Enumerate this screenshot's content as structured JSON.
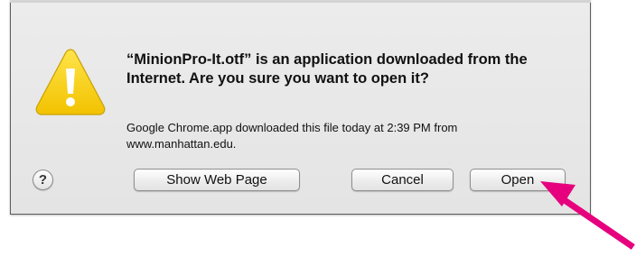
{
  "dialog": {
    "message": "“MinionPro-It.otf” is an application downloaded from the Internet. Are you sure you want to open it?",
    "info": "Google Chrome.app downloaded this file today at 2:39 PM from www.manhattan.edu.",
    "icon": "warning-icon",
    "help_label": "?",
    "buttons": {
      "show_web_page": "Show Web Page",
      "cancel": "Cancel",
      "open": "Open"
    }
  },
  "annotation": {
    "icon": "arrow-icon",
    "color": "#e6007e"
  },
  "colors": {
    "warning_yellow": "#f5d000",
    "dialog_bg": "#e8e8e8"
  }
}
